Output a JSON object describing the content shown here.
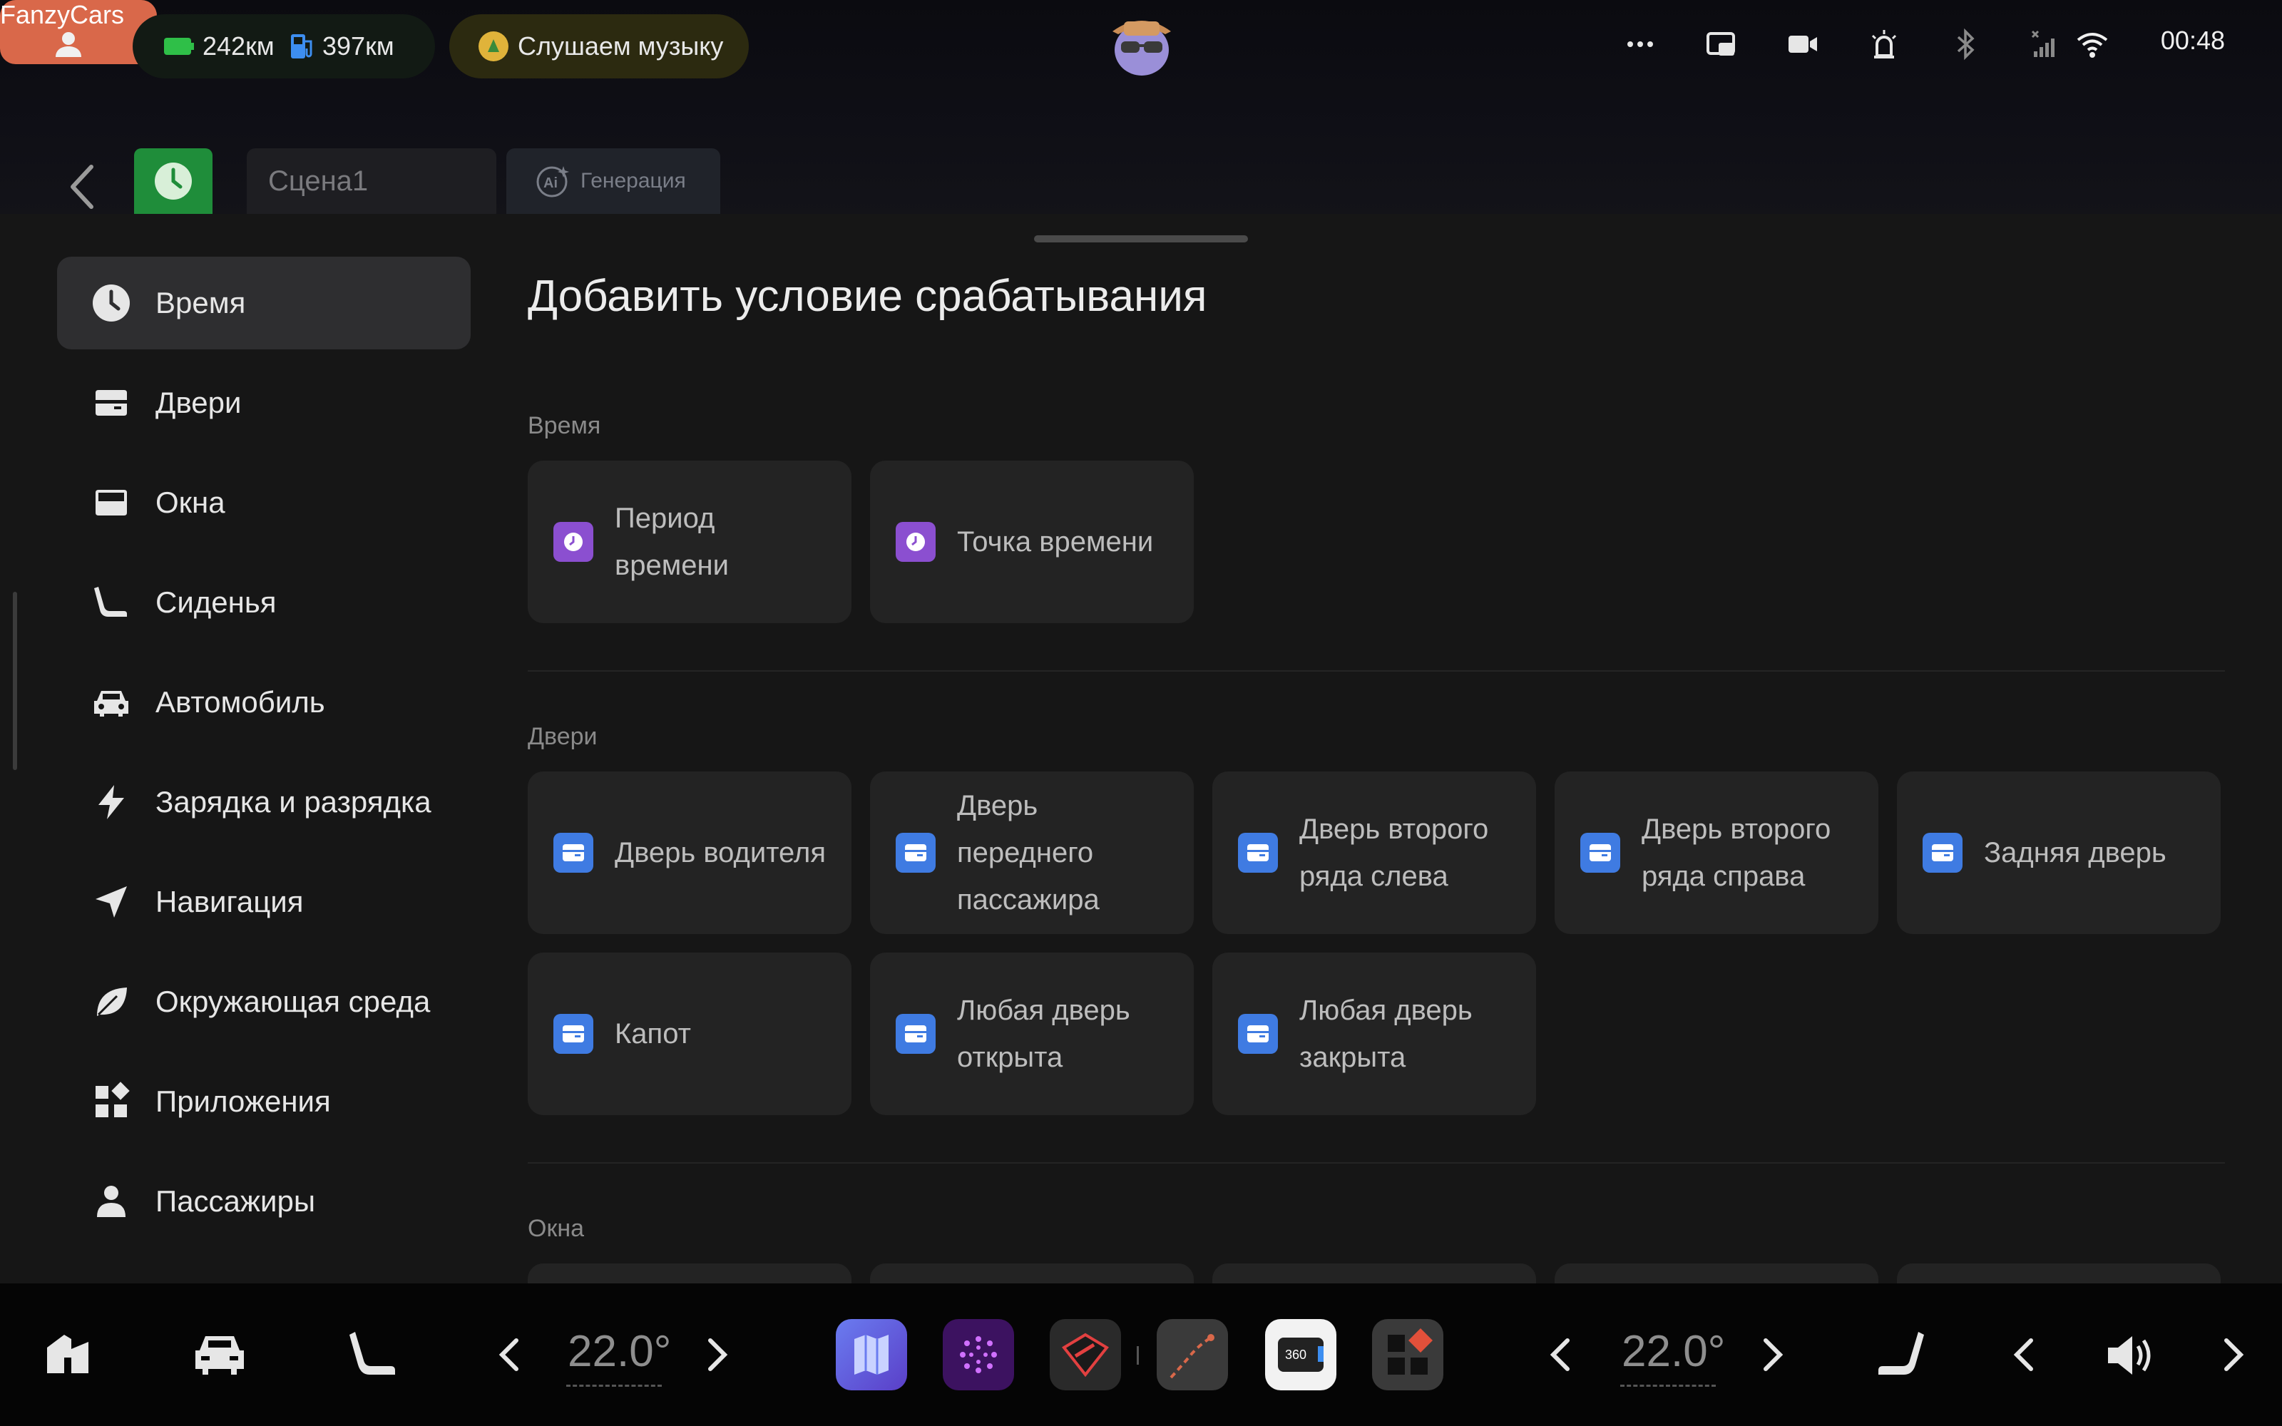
{
  "status_bar": {
    "electric_range": "242км",
    "fuel_range": "397км",
    "music_status": "Слушаем музыку",
    "brand_label": "FanzyCars",
    "time": "00:48",
    "icons": [
      "user-icon",
      "battery-icon",
      "fuel-icon",
      "music-app-icon",
      "avatar",
      "more-icon",
      "pip-icon",
      "camera-icon",
      "alert-icon",
      "bluetooth-icon",
      "signal-icon",
      "wifi-icon"
    ]
  },
  "scene": {
    "name": "Сцена1",
    "generate_label": "Генерация",
    "icon": "clock-icon"
  },
  "sidebar": {
    "items": [
      {
        "label": "Время",
        "icon": "clock-icon",
        "active": true
      },
      {
        "label": "Двери",
        "icon": "door-icon"
      },
      {
        "label": "Окна",
        "icon": "window-icon"
      },
      {
        "label": "Сиденья",
        "icon": "seat-icon"
      },
      {
        "label": "Автомобиль",
        "icon": "car-icon"
      },
      {
        "label": "Зарядка и разрядка",
        "icon": "bolt-icon"
      },
      {
        "label": "Навигация",
        "icon": "navigation-icon"
      },
      {
        "label": "Окружающая среда",
        "icon": "leaf-icon"
      },
      {
        "label": "Приложения",
        "icon": "apps-icon"
      },
      {
        "label": "Пассажиры",
        "icon": "person-icon"
      }
    ]
  },
  "content": {
    "title": "Добавить условие срабатывания",
    "sections": [
      {
        "title": "Время",
        "cards": [
          "Период времени",
          "Точка времени"
        ]
      },
      {
        "title": "Двери",
        "cards": [
          "Дверь водителя",
          "Дверь переднего пассажира",
          "Дверь второго ряда слева",
          "Дверь второго ряда справа",
          "Задняя дверь",
          "Капот",
          "Любая дверь открыта",
          "Любая дверь закрыта"
        ]
      },
      {
        "title": "Окна",
        "cards": []
      }
    ]
  },
  "dock": {
    "left_temp": "22.0°",
    "right_temp": "22.0°",
    "icons": [
      "home-icon",
      "car-icon",
      "seat-icon",
      "maps-app-icon",
      "media-app-icon",
      "game-app-icon",
      "navigation-app-icon",
      "camera-360-app-icon",
      "app-launcher-icon",
      "seat-heat-icon",
      "volume-icon"
    ],
    "camera_label": "360"
  },
  "colors": {
    "accent_brand": "#d9684a",
    "scene_green": "#1f8d3a",
    "time_icon": "#8b4fd0",
    "door_icon": "#3f7be2"
  }
}
